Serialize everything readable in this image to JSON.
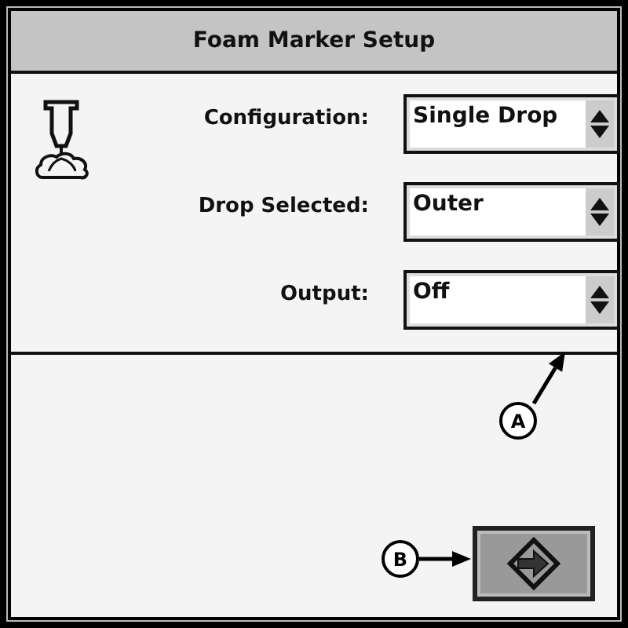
{
  "window": {
    "title": "Foam Marker Setup"
  },
  "fields": [
    {
      "label": "Configuration:",
      "value": "Single Drop"
    },
    {
      "label": "Drop Selected:",
      "value": "Outer"
    },
    {
      "label": "Output:",
      "value": "Off"
    }
  ],
  "callouts": [
    {
      "letter": "A"
    },
    {
      "letter": "B"
    }
  ]
}
